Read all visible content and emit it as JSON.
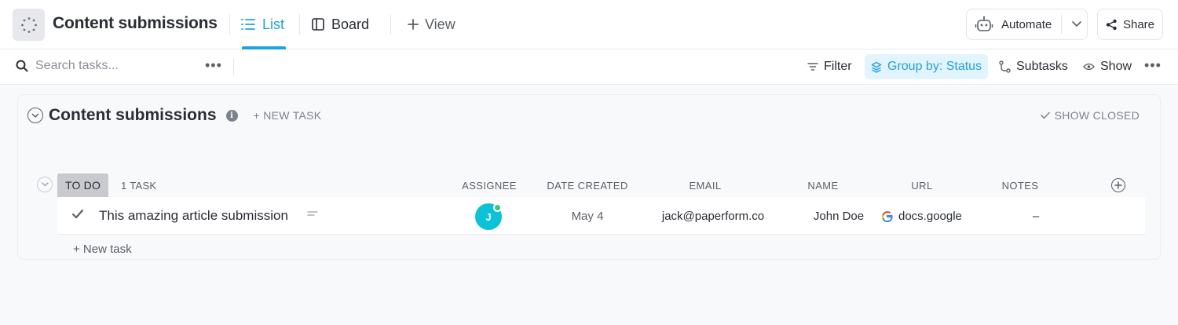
{
  "header": {
    "title": "Content submissions",
    "tabs": [
      {
        "label": "List",
        "active": true,
        "icon": "list-icon"
      },
      {
        "label": "Board",
        "active": false,
        "icon": "board-icon"
      }
    ],
    "add_view_label": "View",
    "automate_label": "Automate",
    "share_label": "Share",
    "accent_color": "#1ea2e6"
  },
  "toolbar": {
    "search_placeholder": "Search tasks...",
    "filter_label": "Filter",
    "group_by_label": "Group by: Status",
    "subtasks_label": "Subtasks",
    "show_label": "Show"
  },
  "list": {
    "title": "Content submissions",
    "new_task_label": "+ NEW TASK",
    "show_closed_label": "SHOW CLOSED",
    "group": {
      "status": "TO DO",
      "count_label": "1 TASK",
      "columns": [
        "ASSIGNEE",
        "DATE CREATED",
        "EMAIL",
        "NAME",
        "URL",
        "NOTES"
      ]
    },
    "tasks": [
      {
        "name": "This amazing article submission",
        "assignee_initial": "J",
        "date_created": "May 4",
        "email": "jack@paperform.co",
        "person_name": "John Doe",
        "url": "docs.google",
        "notes": "–"
      }
    ],
    "add_task_label": "+ New task"
  }
}
